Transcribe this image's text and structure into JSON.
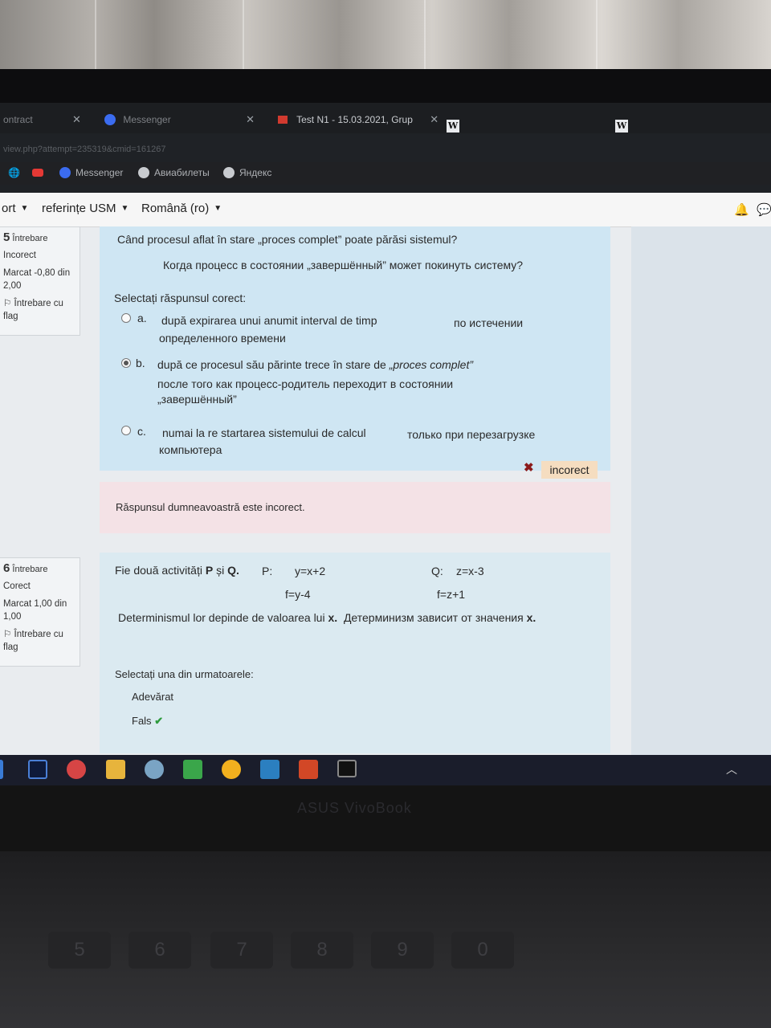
{
  "browser": {
    "tabs": [
      {
        "label": "ontract",
        "active": false
      },
      {
        "label": "Messenger",
        "active": false
      },
      {
        "label": "Test N1 - 15.03.2021, Grup",
        "active": true
      }
    ],
    "url_fragment": "view.php?attempt=235319&cmid=161267",
    "bookmarks": [
      {
        "label": "Messenger",
        "icon": "messenger-icon"
      },
      {
        "label": "Авиабилеты",
        "icon": "globe-icon"
      },
      {
        "label": "Яндекс",
        "icon": "globe-icon"
      }
    ]
  },
  "navbar": {
    "items": [
      "ort",
      "referințe USM",
      "Română (ro)"
    ]
  },
  "question5": {
    "number": "5",
    "word": "Întrebare",
    "status": "Incorect",
    "marks": "Marcat -0,80 din 2,00",
    "flag": "Întrebare cu flag",
    "text_ro": "Când procesul aflat în stare „proces complet” poate părăsi sistemul?",
    "text_ru": "Когда процесс в состоянии „завершённый” может покинуть систему?",
    "prompt": "Selectați răspunsul corect:",
    "options": [
      {
        "letter": "a.",
        "ro": "după expirarea unui anumit interval de timp",
        "ru1": "по  истечении",
        "ru2": "определенного времени",
        "selected": false
      },
      {
        "letter": "b.",
        "ro": "după ce procesul său părinte trece în stare de",
        "ro_em": "„proces complet”",
        "ru1": "после того как процесс-родитель переходит в состоянии",
        "ru2": "„завершённый”",
        "selected": true
      },
      {
        "letter": "c.",
        "ro": "numai la re startarea sistemului de calcul",
        "ru1": "только при перезагрузке",
        "ru2": "компьютера",
        "selected": false
      }
    ],
    "badge": "incorect",
    "feedback": "Răspunsul dumneavoastră este incorect."
  },
  "question6": {
    "number": "6",
    "word": "Întrebare",
    "status": "Corect",
    "marks": "Marcat 1,00 din 1,00",
    "flag": "Întrebare cu flag",
    "line1_pre": "Fie două activități",
    "line1_bold": "P",
    "line1_and": "și",
    "line1_bold2": "Q.",
    "p_label": "P:",
    "p_eq1": "y=x+2",
    "p_eq2": "f=y-4",
    "q_label": "Q:",
    "q_eq1": "z=x-3",
    "q_eq2": "f=z+1",
    "line2_ro": "Determinismul lor depinde de valoarea lui",
    "line2_x": "x.",
    "line2_ru": "Детерминизм зависит от значения",
    "line2_x2": "x.",
    "prompt": "Selectați una din urmatoarele:",
    "options": [
      "Adevărat",
      "Fals"
    ]
  },
  "laptop_brand": "ASUS VivoBook",
  "keys": [
    "5",
    "6",
    "7",
    "8",
    "9",
    "0"
  ],
  "colors": {
    "question_bg": "#cfe6f3",
    "feedback_bg": "#f4e2e6",
    "badge_bg": "#f5ddc0",
    "check": "#2e9b3e",
    "cross": "#8b1b1b"
  }
}
